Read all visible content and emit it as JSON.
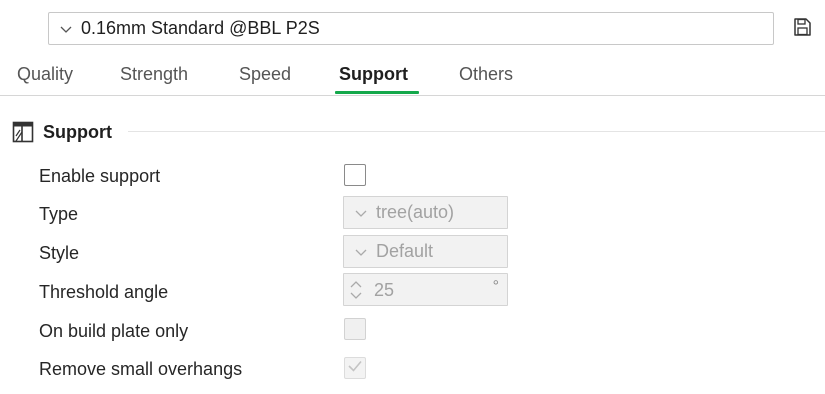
{
  "preset": {
    "selected": "0.16mm Standard @BBL P2S",
    "chevron_icon": "chevron-down-icon",
    "save_icon": "save-icon"
  },
  "tabs": [
    {
      "label": "Quality",
      "active": false
    },
    {
      "label": "Strength",
      "active": false
    },
    {
      "label": "Speed",
      "active": false
    },
    {
      "label": "Support",
      "active": true
    },
    {
      "label": "Others",
      "active": false
    }
  ],
  "colors": {
    "accent": "#14a84b",
    "disabled_text": "#a2a2a2",
    "disabled_bg": "#f2f2f2"
  },
  "section": {
    "title": "Support",
    "icon": "support-icon"
  },
  "rows": {
    "enable_support": {
      "label": "Enable support",
      "checked": false,
      "enabled": true
    },
    "type": {
      "label": "Type",
      "value": "tree(auto)",
      "enabled": false
    },
    "style": {
      "label": "Style",
      "value": "Default",
      "enabled": false
    },
    "threshold_angle": {
      "label": "Threshold angle",
      "value": "25",
      "unit": "°",
      "enabled": false
    },
    "on_build_plate_only": {
      "label": "On build plate only",
      "checked": false,
      "enabled": false
    },
    "remove_small_overhangs": {
      "label": "Remove small overhangs",
      "checked": true,
      "enabled": false
    }
  }
}
